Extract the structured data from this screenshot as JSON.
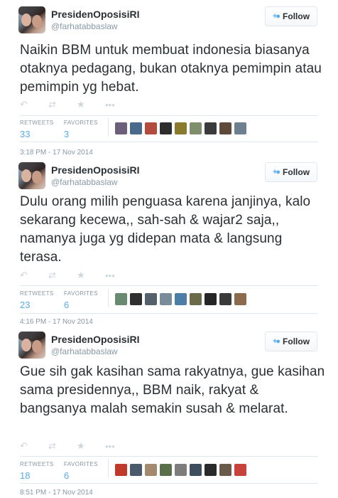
{
  "tweets": [
    {
      "name": "PresidenOposisiRI",
      "handle": "@farhatabbaslaw",
      "follow_label": "Follow",
      "text": "Naikin BBM untuk membuat indonesia biasanya otaknya pedagang, bukan otaknya pemimpin atau pemimpin yg hebat.",
      "retweets_label": "RETWEETS",
      "retweets": "33",
      "favorites_label": "FAVORITES",
      "favorites": "3",
      "timestamp": "3:18 PM - 17 Nov 2014"
    },
    {
      "name": "PresidenOposisiRI",
      "handle": "@farhatabbaslaw",
      "follow_label": "Follow",
      "text": "Dulu orang milih penguasa karena janjinya, kalo sekarang kecewa,, sah-sah & wajar2 saja,, namanya juga yg didepan mata & langsung terasa.",
      "retweets_label": "RETWEETS",
      "retweets": "23",
      "favorites_label": "FAVORITES",
      "favorites": "6",
      "timestamp": "4:16 PM - 17 Nov 2014"
    },
    {
      "name": "PresidenOposisiRI",
      "handle": "@farhatabbaslaw",
      "follow_label": "Follow",
      "text": "Gue sih gak kasihan sama rakyatnya, gue kasihan sama presidennya,, BBM naik, rakyat & bangsanya malah semakin susah & melarat.",
      "retweets_label": "RETWEETS",
      "retweets": "18",
      "favorites_label": "FAVORITES",
      "favorites": "6",
      "timestamp": "8:51 PM - 17 Nov 2014"
    }
  ],
  "icons": {
    "reply": "reply-icon",
    "retweet": "retweet-icon",
    "favorite": "star-icon",
    "more": "more-icon",
    "follow": "person-plus-icon"
  },
  "colors": {
    "accent": "#55acee",
    "text": "#292f33",
    "muted": "#8899a6",
    "border": "#e1e8ed"
  }
}
